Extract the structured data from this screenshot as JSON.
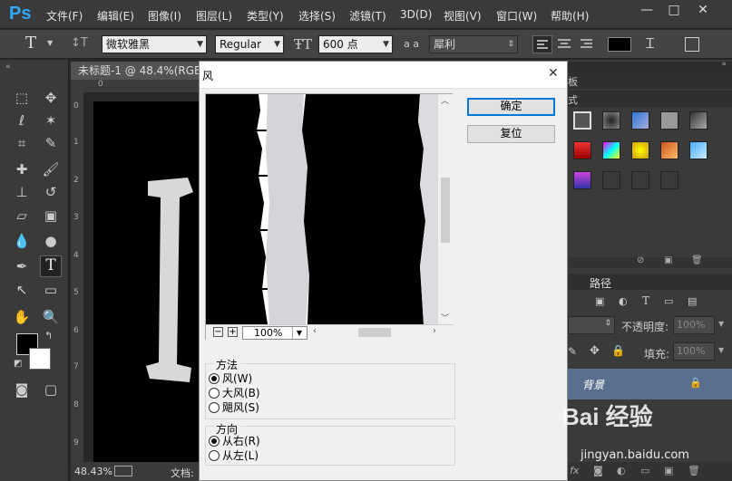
{
  "app": {
    "logo": "Ps"
  },
  "menu": [
    "文件(F)",
    "编辑(E)",
    "图像(I)",
    "图层(L)",
    "类型(Y)",
    "选择(S)",
    "滤镜(T)",
    "3D(D)",
    "视图(V)",
    "窗口(W)",
    "帮助(H)"
  ],
  "window_controls": {
    "minimize": "—",
    "restore": "□",
    "close": "✕"
  },
  "options": {
    "tool_glyph": "T",
    "font_family": "微软雅黑",
    "font_style": "Regular",
    "font_size": "600 点",
    "aa_label": "a a",
    "antialias": "犀利"
  },
  "document": {
    "tab_title": "未标题-1 @ 48.4%(RGB",
    "zoom": "48.43%",
    "status_label": "文档:",
    "ruler_ticks": [
      "0",
      "1",
      "2",
      "3",
      "4",
      "5",
      "6",
      "7",
      "8",
      "9"
    ]
  },
  "panels": {
    "top_tabs": [
      "板",
      "式"
    ],
    "layers_tab": "路径",
    "opacity_label": "不透明度:",
    "opacity_value": "100%",
    "fill_label": "填充:",
    "fill_value": "100%",
    "layer_name": "背景"
  },
  "dialog": {
    "title": "风",
    "close": "✕",
    "ok": "确定",
    "reset": "复位",
    "zoom_value": "100%",
    "zoom_minus": "−",
    "zoom_plus": "+",
    "method_title": "方法",
    "methods": [
      "风(W)",
      "大风(B)",
      "飓风(S)"
    ],
    "selected_method": 0,
    "direction_title": "方向",
    "directions": [
      "从右(R)",
      "从左(L)"
    ],
    "selected_direction": 0
  },
  "watermark": {
    "brand": "Bai 经验",
    "url": "jingyan.baidu.com"
  }
}
